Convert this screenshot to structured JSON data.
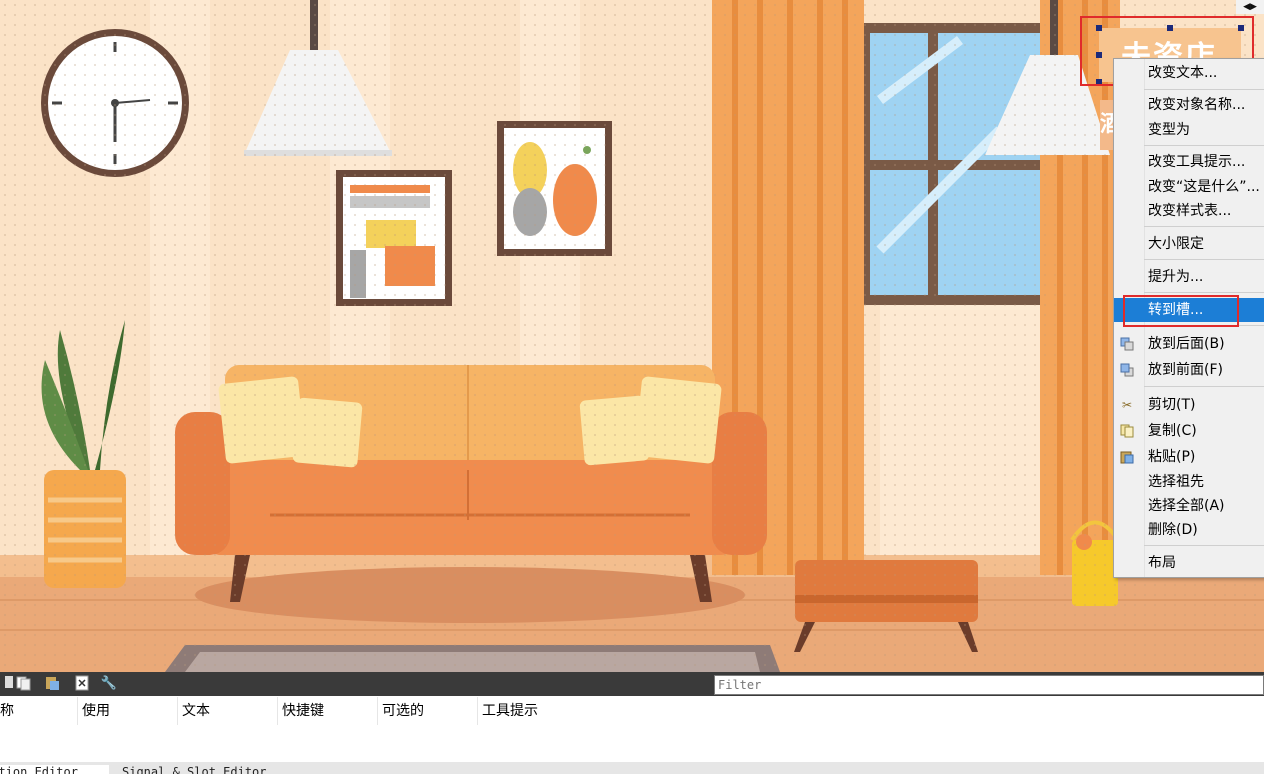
{
  "canvas": {
    "selected_widget_text": "未资店",
    "second_widget_text": "酒",
    "nav_arrows": "◀▶"
  },
  "context_menu": {
    "items": [
      {
        "label": "改变文本...",
        "icon": ""
      },
      {
        "label": "改变对象名称...",
        "icon": ""
      },
      {
        "label": "变型为",
        "icon": ""
      },
      {
        "label": "改变工具提示...",
        "icon": ""
      },
      {
        "label": "改变“这是什么”...",
        "icon": ""
      },
      {
        "label": "改变样式表...",
        "icon": ""
      },
      {
        "label": "大小限定",
        "icon": ""
      },
      {
        "label": "提升为...",
        "icon": ""
      },
      {
        "label": "转到槽...",
        "icon": ""
      },
      {
        "label": "放到后面(B)",
        "icon": "send-back-icon"
      },
      {
        "label": "放到前面(F)",
        "icon": "bring-front-icon"
      },
      {
        "label": "剪切(T)",
        "icon": "scissors-icon"
      },
      {
        "label": "复制(C)",
        "icon": "copy-icon"
      },
      {
        "label": "粘贴(P)",
        "icon": "paste-icon"
      },
      {
        "label": "选择祖先",
        "icon": ""
      },
      {
        "label": "选择全部(A)",
        "icon": ""
      },
      {
        "label": "删除(D)",
        "icon": ""
      },
      {
        "label": "布局",
        "icon": ""
      }
    ],
    "highlight_color": "#1c7ed6"
  },
  "action_editor": {
    "filter_placeholder": "Filter",
    "columns": [
      "称",
      "使用",
      "文本",
      "快捷键",
      "可选的",
      "工具提示"
    ],
    "tabs": [
      "Action Editor",
      "Signal & Slot Editor"
    ]
  },
  "colors": {
    "annotation_red": "#e02b2b",
    "selection_handle": "#1d2a7a"
  }
}
